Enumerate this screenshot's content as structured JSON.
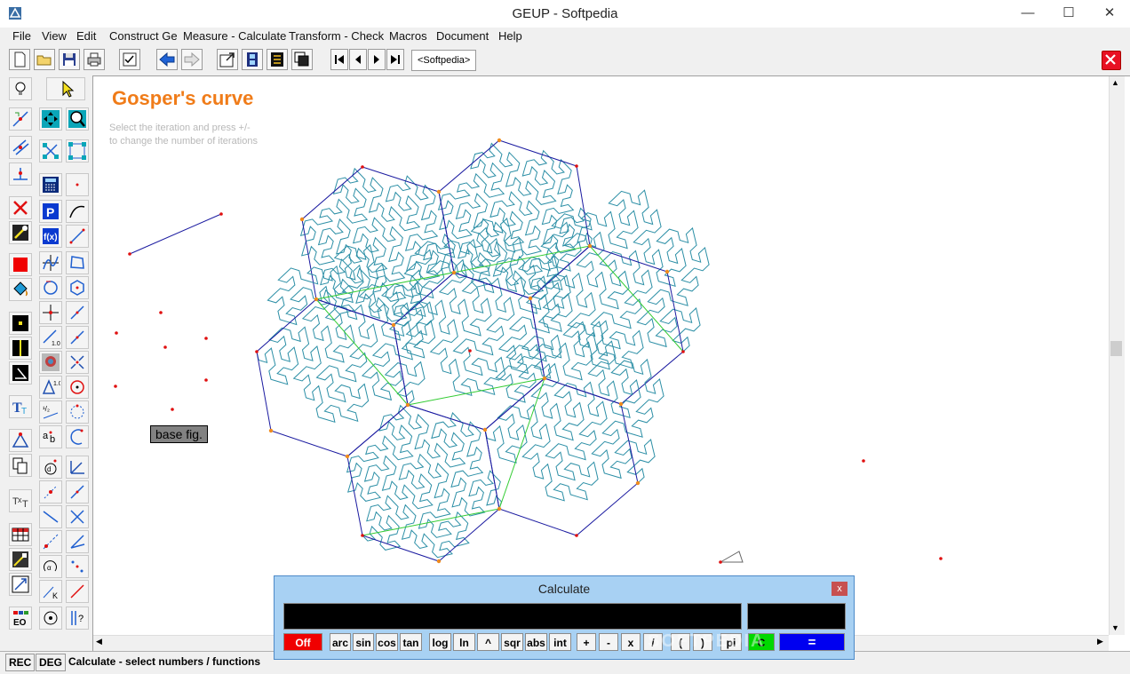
{
  "window": {
    "title": "GEUP - Softpedia",
    "controls": {
      "minimize": "—",
      "maximize": "☐",
      "close": "✕"
    }
  },
  "menu": {
    "items": [
      "File",
      "Edit",
      "Construct Ge",
      "Measure - Calculate",
      "Transform - Check",
      "Macros",
      "Document",
      "Help"
    ],
    "view": "View"
  },
  "toolbar": {
    "tab_label": "<Softpedia>"
  },
  "canvas": {
    "heading": "Gosper's curve",
    "instructions_line1": "Select the iteration and press +/-",
    "instructions_line2": "to change the number of iterations",
    "base_button": "base fig.",
    "colors": {
      "heading": "#f07c19",
      "hex_outline": "#1a1aa0",
      "curve": "#2c8fa6",
      "connector": "#33cc33",
      "vertex_orange": "#f08c1e",
      "vertex_red": "#e01010"
    }
  },
  "calculator": {
    "title": "Calculate",
    "close": "x",
    "keys": {
      "off": "Off",
      "arc": "arc",
      "sin": "sin",
      "cos": "cos",
      "tan": "tan",
      "log": "log",
      "ln": "ln",
      "pow": "^",
      "sqr": "sqr",
      "abs": "abs",
      "int": "int",
      "plus": "+",
      "minus": "-",
      "times": "x",
      "divide": "/",
      "lparen": "(",
      "rparen": ")",
      "pi": "pi",
      "clear": "C",
      "equals": "="
    }
  },
  "status": {
    "rec": "REC",
    "deg": "DEG",
    "message": "Calculate - select numbers / functions"
  },
  "watermark": "SOFTPEDIA"
}
